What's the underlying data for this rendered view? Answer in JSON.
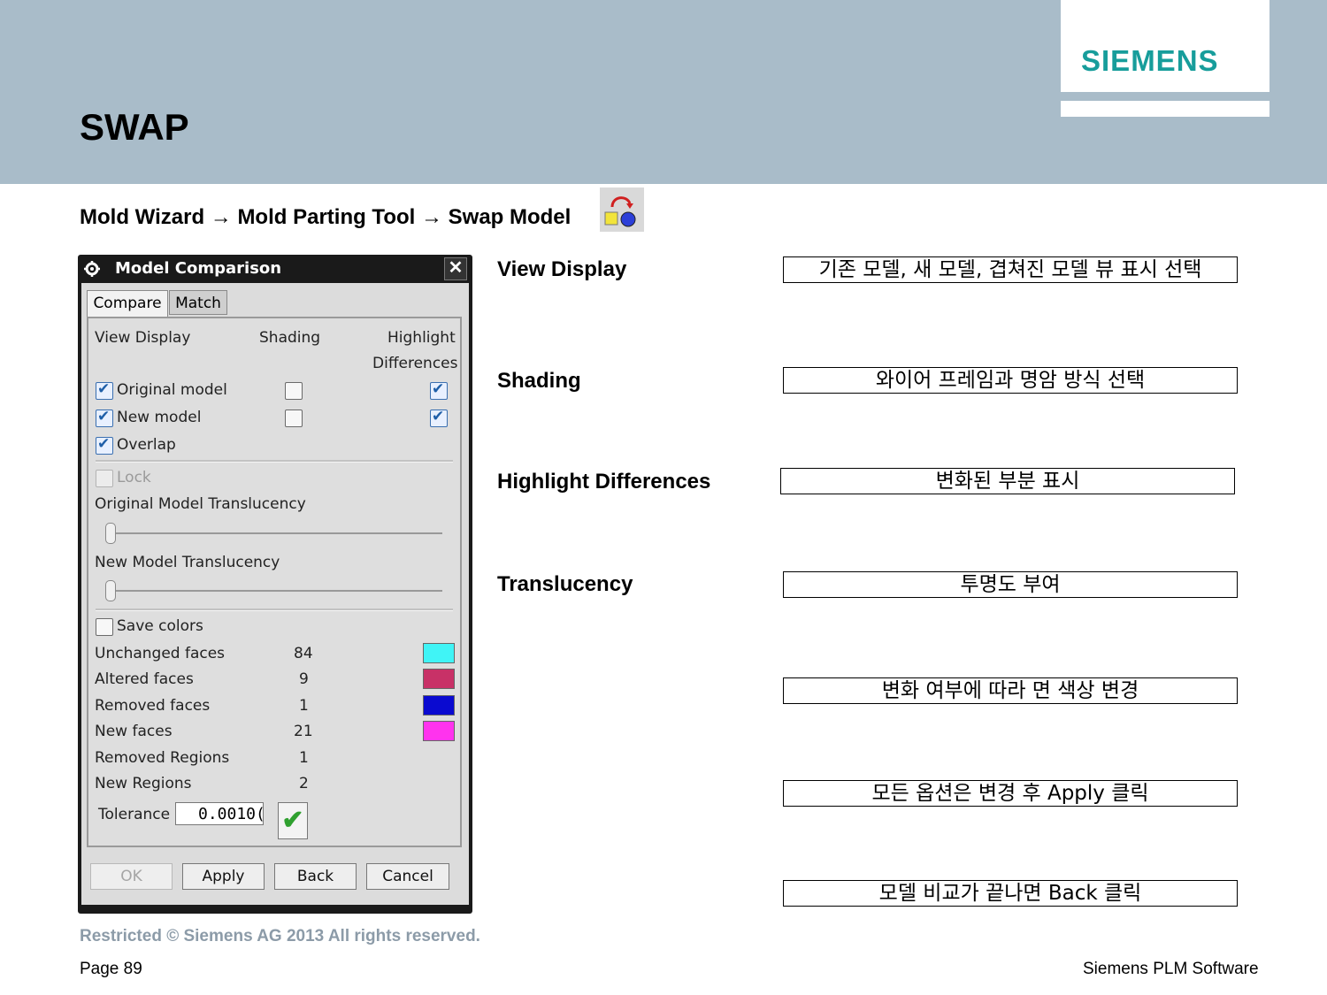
{
  "brand": {
    "logo_text": "SIEMENS",
    "accent_color": "#179d9b",
    "header_color": "#a9bcc9"
  },
  "slide": {
    "title": "SWAP",
    "breadcrumb": "Mold Wizard → Mold Parting Tool → Swap Model",
    "swap_icon": "swap-model-icon"
  },
  "dialog": {
    "title": "Model Comparison",
    "tabs": [
      "Compare",
      "Match"
    ],
    "active_tab": "Compare",
    "headers": {
      "view_display": "View Display",
      "shading": "Shading",
      "highlight_1": "Highlight",
      "highlight_2": "Differences"
    },
    "rows": [
      {
        "label": "Original model",
        "view_checked": true,
        "shading_checked": false,
        "highlight_checked": true
      },
      {
        "label": "New model",
        "view_checked": true,
        "shading_checked": false,
        "highlight_checked": true
      },
      {
        "label": "Overlap",
        "view_checked": true
      }
    ],
    "lock_label": "Lock",
    "original_translucency_label": "Original Model Translucency",
    "original_translucency": 0,
    "new_translucency_label": "New Model Translucency",
    "new_translucency": 0,
    "save_colors_label": "Save colors",
    "save_colors_checked": false,
    "face_stats": [
      {
        "label": "Unchanged faces",
        "count": "84",
        "color": "#40f4f6"
      },
      {
        "label": "Altered faces",
        "count": "9",
        "color": "#c83167"
      },
      {
        "label": "Removed faces",
        "count": "1",
        "color": "#0a0ad0"
      },
      {
        "label": "New faces",
        "count": "21",
        "color": "#ff33ee"
      },
      {
        "label": "Removed Regions",
        "count": "1"
      },
      {
        "label": "New Regions",
        "count": "2"
      }
    ],
    "tolerance_label": "Tolerance",
    "tolerance_value": "0.0010(",
    "buttons": {
      "ok": "OK",
      "apply": "Apply",
      "back": "Back",
      "cancel": "Cancel"
    }
  },
  "annotations": {
    "labels": [
      "View Display",
      "Shading",
      "Highlight Differences",
      "Translucency"
    ],
    "boxes": [
      "기존 모델, 새 모델, 겹쳐진 모델 뷰 표시 선택",
      "와이어 프레임과 명암 방식 선택",
      "변화된 부분 표시",
      "투명도 부여",
      "변화 여부에 따라 면 색상 변경",
      "모든 옵션은 변경 후 Apply 클릭",
      "모델 비교가 끝나면 Back 클릭"
    ]
  },
  "footer": {
    "restricted": "Restricted © Siemens AG 2013 All rights reserved.",
    "page": "Page 89",
    "company": "Siemens PLM Software"
  }
}
